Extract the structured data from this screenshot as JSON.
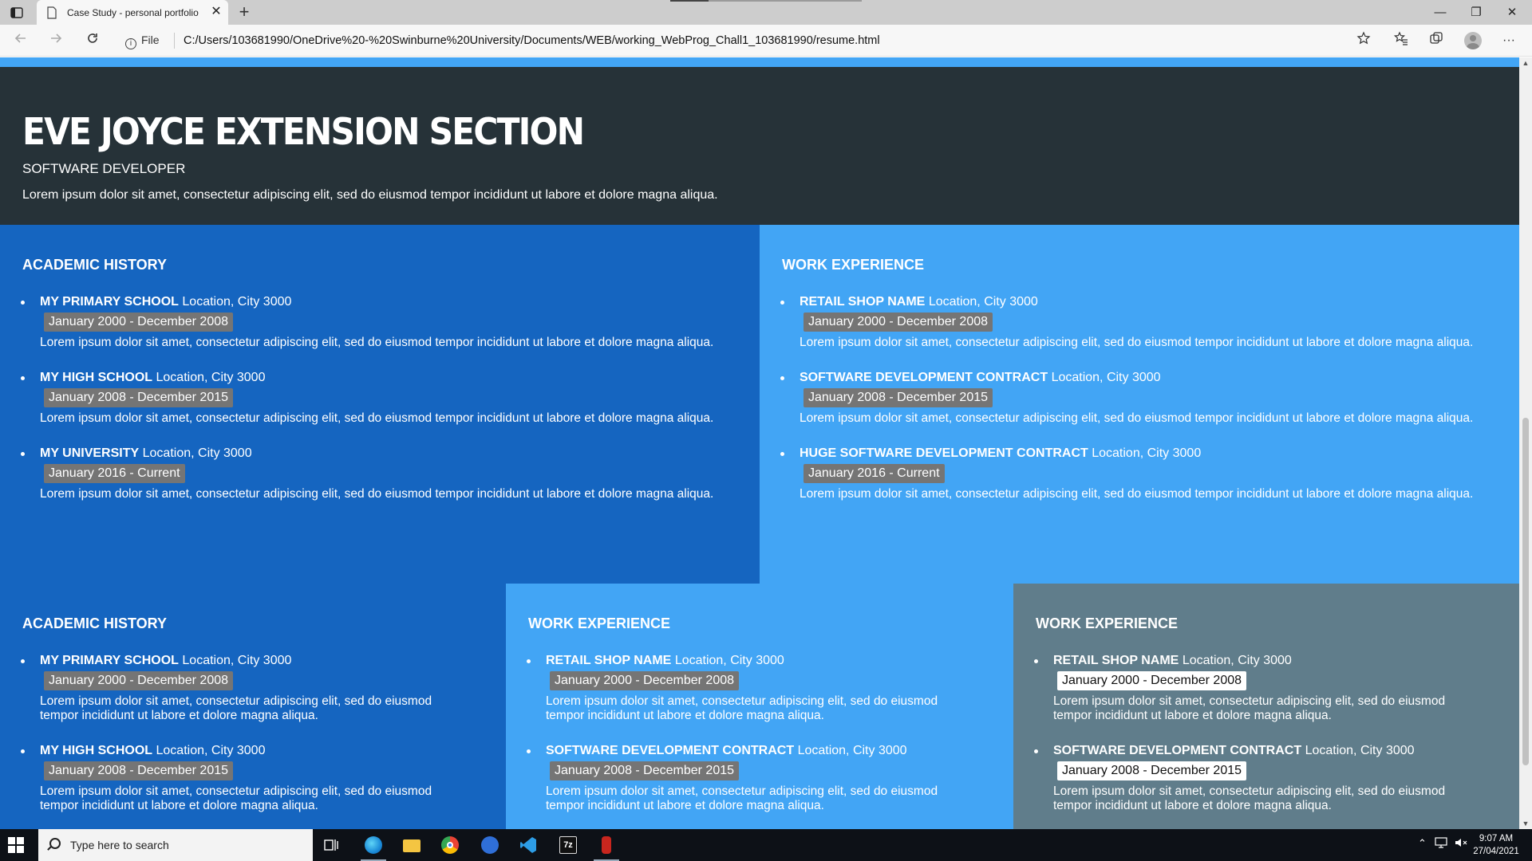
{
  "browser": {
    "tab_title": "Case Study - personal portfolio",
    "tab_close": "✕",
    "new_tab": "+",
    "address_prefix": "File",
    "url": "C:/Users/103681990/OneDrive%20-%20Swinburne%20University/Documents/WEB/working_WebProg_Chall1_103681990/resume.html",
    "window": {
      "minimize": "—",
      "restore": "❐",
      "close": "✕"
    },
    "toolbar_icons": [
      "favorite-add-icon",
      "favorites-icon",
      "collections-icon",
      "profile-avatar",
      "more-icon"
    ],
    "more": "···"
  },
  "hero": {
    "name": "EVE JOYCE EXTENSION SECTION",
    "role": "SOFTWARE DEVELOPER",
    "intro": "Lorem ipsum dolor sit amet, consectetur adipiscing elit, sed do eiusmod tempor incididunt ut labore et dolore magna aliqua."
  },
  "sections": {
    "academic1": {
      "heading": "ACADEMIC HISTORY",
      "items": [
        {
          "name": "MY PRIMARY SCHOOL",
          "location": "Location, City 3000",
          "date": "January 2000 - December 2008",
          "desc": "Lorem ipsum dolor sit amet, consectetur adipiscing elit, sed do eiusmod tempor incididunt ut labore et dolore magna aliqua."
        },
        {
          "name": "MY HIGH SCHOOL",
          "location": "Location, City 3000",
          "date": "January 2008 - December 2015",
          "desc": "Lorem ipsum dolor sit amet, consectetur adipiscing elit, sed do eiusmod tempor incididunt ut labore et dolore magna aliqua."
        },
        {
          "name": "MY UNIVERSITY",
          "location": "Location, City 3000",
          "date": "January 2016 - Current",
          "desc": "Lorem ipsum dolor sit amet, consectetur adipiscing elit, sed do eiusmod tempor incididunt ut labore et dolore magna aliqua."
        }
      ]
    },
    "work1": {
      "heading": "WORK EXPERIENCE",
      "items": [
        {
          "name": "RETAIL SHOP NAME",
          "location": "Location, City 3000",
          "date": "January 2000 - December 2008",
          "desc": "Lorem ipsum dolor sit amet, consectetur adipiscing elit, sed do eiusmod tempor incididunt ut labore et dolore magna aliqua."
        },
        {
          "name": "SOFTWARE DEVELOPMENT CONTRACT",
          "location": "Location, City 3000",
          "date": "January 2008 - December 2015",
          "desc": "Lorem ipsum dolor sit amet, consectetur adipiscing elit, sed do eiusmod tempor incididunt ut labore et dolore magna aliqua."
        },
        {
          "name": "HUGE SOFTWARE DEVELOPMENT CONTRACT",
          "location": "Location, City 3000",
          "date": "January 2016 - Current",
          "desc": "Lorem ipsum dolor sit amet, consectetur adipiscing elit, sed do eiusmod tempor incididunt ut labore et dolore magna aliqua."
        }
      ]
    },
    "academic2": {
      "heading": "ACADEMIC HISTORY",
      "items": [
        {
          "name": "MY PRIMARY SCHOOL",
          "location": "Location, City 3000",
          "date": "January 2000 - December 2008",
          "desc": "Lorem ipsum dolor sit amet, consectetur adipiscing elit, sed do eiusmod tempor incididunt ut labore et dolore magna aliqua."
        },
        {
          "name": "MY HIGH SCHOOL",
          "location": "Location, City 3000",
          "date": "January 2008 - December 2015",
          "desc": "Lorem ipsum dolor sit amet, consectetur adipiscing elit, sed do eiusmod tempor incididunt ut labore et dolore magna aliqua."
        }
      ]
    },
    "work2": {
      "heading": "WORK EXPERIENCE",
      "items": [
        {
          "name": "RETAIL SHOP NAME",
          "location": "Location, City 3000",
          "date": "January 2000 - December 2008",
          "desc": "Lorem ipsum dolor sit amet, consectetur adipiscing elit, sed do eiusmod tempor incididunt ut labore et dolore magna aliqua."
        },
        {
          "name": "SOFTWARE DEVELOPMENT CONTRACT",
          "location": "Location, City 3000",
          "date": "January 2008 - December 2015",
          "desc": "Lorem ipsum dolor sit amet, consectetur adipiscing elit, sed do eiusmod tempor incididunt ut labore et dolore magna aliqua."
        }
      ]
    },
    "work3": {
      "heading": "WORK EXPERIENCE",
      "items": [
        {
          "name": "RETAIL SHOP NAME",
          "location": "Location, City 3000",
          "date": "January 2000 - December 2008",
          "desc": "Lorem ipsum dolor sit amet, consectetur adipiscing elit, sed do eiusmod tempor incididunt ut labore et dolore magna aliqua."
        },
        {
          "name": "SOFTWARE DEVELOPMENT CONTRACT",
          "location": "Location, City 3000",
          "date": "January 2008 - December 2015",
          "desc": "Lorem ipsum dolor sit amet, consectetur adipiscing elit, sed do eiusmod tempor incididunt ut labore et dolore magna aliqua."
        }
      ]
    }
  },
  "colors": {
    "accent_strip": "#42a5f5",
    "hero_bg": "#263238",
    "dark_blue_panel": "#1565c0",
    "light_blue_panel": "#42a5f5",
    "grey_panel": "#607d8b",
    "date_badge": "#757575"
  },
  "taskbar": {
    "search_placeholder": "Type here to search",
    "apps": [
      "task-view-icon",
      "edge-icon",
      "file-explorer-icon",
      "chrome-icon",
      "ccleaner-icon",
      "vscode-icon",
      "7zip-icon",
      "filezilla-icon"
    ],
    "time": "9:07 AM",
    "date": "27/04/2021"
  }
}
